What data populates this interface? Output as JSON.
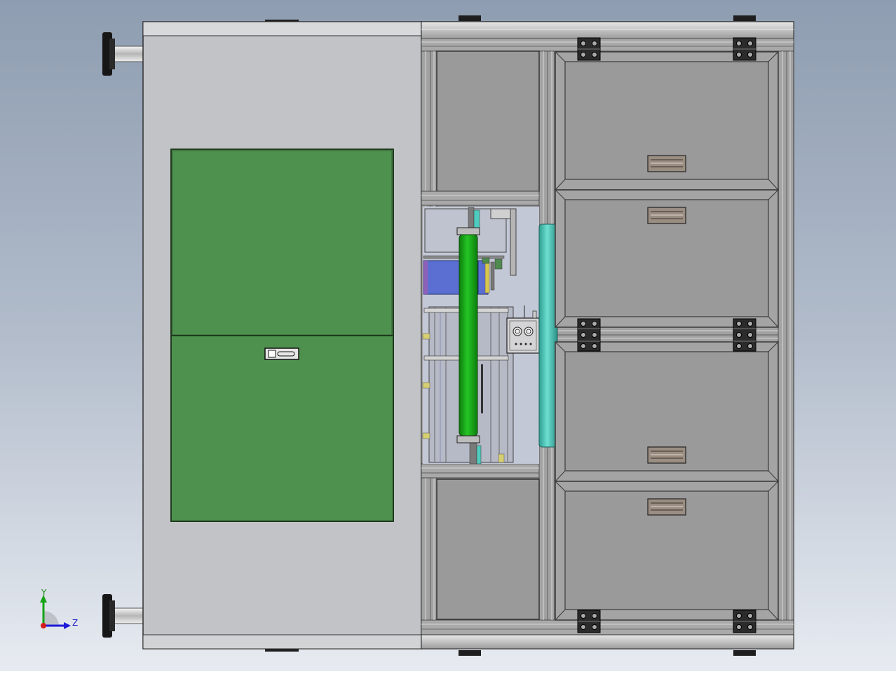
{
  "triad": {
    "y_label": "Y",
    "z_label": "Z"
  },
  "colors": {
    "door_panel": "#4e914e",
    "cylinder": "#1db51d",
    "guide_rail": "#4ecbbd",
    "motor_block": "#5b6fd2",
    "left_housing": "#c2c3c6",
    "frame_panel": "#9a9a9a"
  }
}
